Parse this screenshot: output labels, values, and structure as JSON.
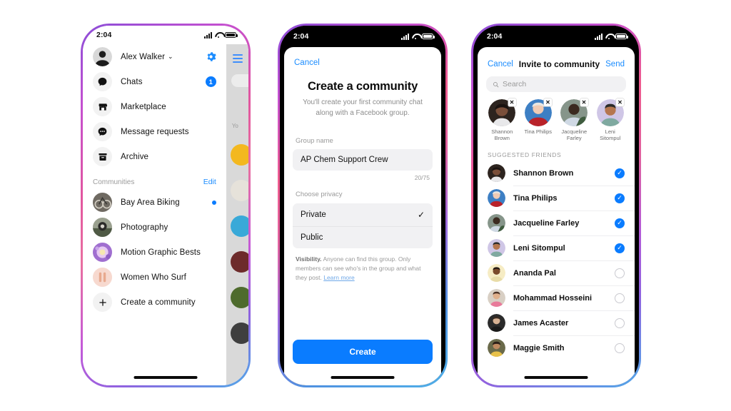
{
  "status_bar": {
    "time": "2:04",
    "signal_icon": "cellular-bars-icon",
    "wifi_icon": "wifi-icon",
    "battery_icon": "battery-icon"
  },
  "phone1": {
    "profile": {
      "name": "Alex Walker",
      "chevron": "⌄",
      "settings_icon": "gear-icon"
    },
    "menu_items": [
      {
        "label": "Chats",
        "icon": "chat-bubble-icon",
        "badge": "1"
      },
      {
        "label": "Marketplace",
        "icon": "storefront-icon",
        "badge": ""
      },
      {
        "label": "Message requests",
        "icon": "message-dots-icon",
        "badge": ""
      },
      {
        "label": "Archive",
        "icon": "archive-box-icon",
        "badge": ""
      }
    ],
    "section": {
      "title": "Communities",
      "edit_label": "Edit"
    },
    "communities": [
      {
        "label": "Bay Area Biking",
        "has_dot": true
      },
      {
        "label": "Photography",
        "has_dot": false
      },
      {
        "label": "Motion Graphic Bests",
        "has_dot": false
      },
      {
        "label": "Women Who Surf",
        "has_dot": false
      }
    ],
    "create": {
      "label": "Create a community",
      "icon": "plus-icon"
    },
    "peek_panel": {
      "menu_icon": "hamburger-icon",
      "search_icon": "search-icon",
      "section_label": "Yo"
    }
  },
  "phone2": {
    "cancel_label": "Cancel",
    "title": "Create a community",
    "subtitle": "You'll create your first community chat along with a Facebook group.",
    "group_name_label": "Group name",
    "group_name_value": "AP Chem Support Crew",
    "counter": "20/75",
    "privacy_label": "Choose privacy",
    "privacy_options": [
      {
        "label": "Private",
        "selected": true,
        "check": "✓"
      },
      {
        "label": "Public",
        "selected": false,
        "check": ""
      }
    ],
    "helper_bold": "Visibility.",
    "helper_text": " Anyone can find this group. Only members can see who's in the group and what they post. ",
    "helper_link": "Learn more",
    "create_label": "Create"
  },
  "phone3": {
    "cancel_label": "Cancel",
    "title": "Invite to community",
    "send_label": "Send",
    "search_placeholder": "Search",
    "search_icon": "search-icon",
    "selected_chips": [
      {
        "name": "Shannon Brown",
        "remove_icon": "close-x-icon"
      },
      {
        "name": "Tina Philips",
        "remove_icon": "close-x-icon"
      },
      {
        "name": "Jacqueline Farley",
        "remove_icon": "close-x-icon"
      },
      {
        "name": "Leni Sitompul",
        "remove_icon": "close-x-icon"
      }
    ],
    "section_label": "SUGGESTED FRIENDS",
    "friends": [
      {
        "name": "Shannon Brown",
        "selected": true
      },
      {
        "name": "Tina Philips",
        "selected": true
      },
      {
        "name": "Jacqueline Farley",
        "selected": true
      },
      {
        "name": "Leni Sitompul",
        "selected": true
      },
      {
        "name": "Ananda Pal",
        "selected": false
      },
      {
        "name": "Mohammad Hosseini",
        "selected": false
      },
      {
        "name": "James Acaster",
        "selected": false
      },
      {
        "name": "Maggie Smith",
        "selected": false
      }
    ],
    "check_glyph": "✓"
  },
  "colors": {
    "accent_blue": "#0a7cff",
    "link_blue": "#1a8cff",
    "panel_gray": "#f1f1f3",
    "muted_text": "#9a9a9a"
  }
}
